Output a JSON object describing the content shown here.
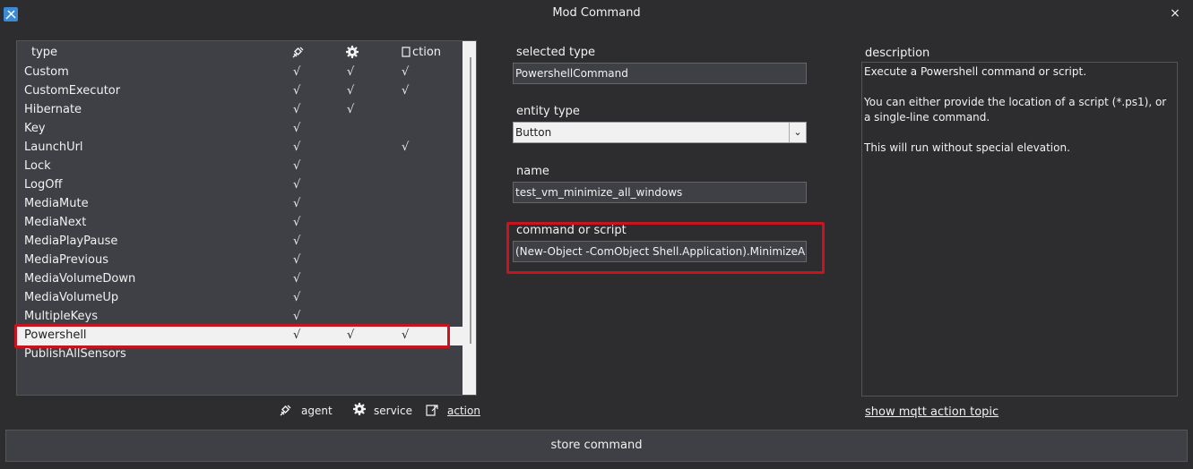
{
  "window": {
    "title": "Mod Command",
    "close_label": "×"
  },
  "list": {
    "headers": {
      "type": "type",
      "action": "ction"
    },
    "rows": [
      {
        "name": "Custom",
        "agent": "√",
        "service": "√",
        "action": "√"
      },
      {
        "name": "CustomExecutor",
        "agent": "√",
        "service": "√",
        "action": "√"
      },
      {
        "name": "Hibernate",
        "agent": "√",
        "service": "√",
        "action": ""
      },
      {
        "name": "Key",
        "agent": "√",
        "service": "",
        "action": ""
      },
      {
        "name": "LaunchUrl",
        "agent": "√",
        "service": "",
        "action": "√"
      },
      {
        "name": "Lock",
        "agent": "√",
        "service": "",
        "action": ""
      },
      {
        "name": "LogOff",
        "agent": "√",
        "service": "",
        "action": ""
      },
      {
        "name": "MediaMute",
        "agent": "√",
        "service": "",
        "action": ""
      },
      {
        "name": "MediaNext",
        "agent": "√",
        "service": "",
        "action": ""
      },
      {
        "name": "MediaPlayPause",
        "agent": "√",
        "service": "",
        "action": ""
      },
      {
        "name": "MediaPrevious",
        "agent": "√",
        "service": "",
        "action": ""
      },
      {
        "name": "MediaVolumeDown",
        "agent": "√",
        "service": "",
        "action": ""
      },
      {
        "name": "MediaVolumeUp",
        "agent": "√",
        "service": "",
        "action": ""
      },
      {
        "name": "MultipleKeys",
        "agent": "√",
        "service": "",
        "action": ""
      },
      {
        "name": "Powershell",
        "agent": "√",
        "service": "√",
        "action": "√",
        "selected": true
      },
      {
        "name": "PublishAllSensors",
        "agent": "",
        "service": "",
        "action": ""
      }
    ]
  },
  "legend": {
    "agent": "agent",
    "service": "service",
    "action": "action"
  },
  "form": {
    "selected_type_label": "selected type",
    "selected_type_value": "PowershellCommand",
    "entity_type_label": "entity type",
    "entity_type_value": "Button",
    "name_label": "name",
    "name_value": "test_vm_minimize_all_windows",
    "command_label": "command or script",
    "command_value": "(New-Object -ComObject Shell.Application).MinimizeAll("
  },
  "description": {
    "label": "description",
    "paragraphs": [
      "Execute a Powershell command or script.",
      "You can either provide the location of a script (*.ps1), or a single-line command.",
      "This will run without special elevation."
    ],
    "mqtt_link": "show mqtt action topic"
  },
  "store_button": "store command",
  "icons": {
    "app": "app-icon",
    "agent": "satellite-icon",
    "service": "gear-icon",
    "action": "action-icon"
  },
  "colors": {
    "background": "#2d2d30",
    "panel": "#3f3f46",
    "highlight": "#c8141e",
    "selected_row": "#f1f1f1"
  }
}
